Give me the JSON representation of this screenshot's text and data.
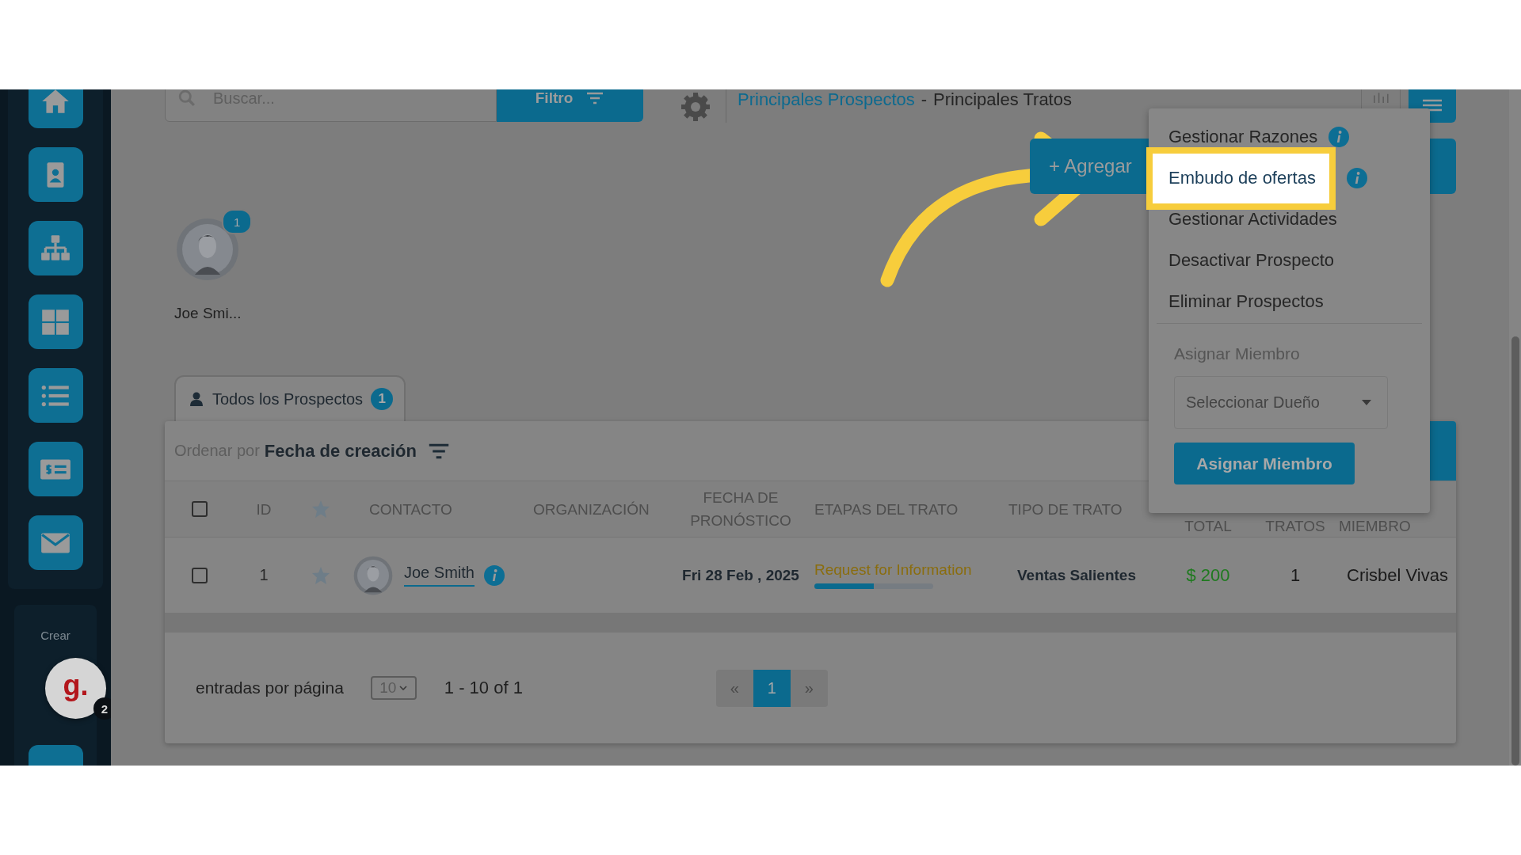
{
  "sidebar": {
    "section_label": "Crear",
    "widget": {
      "letter": "g.",
      "badge": "2"
    }
  },
  "search": {
    "placeholder": "Buscar..."
  },
  "filter_button": "Filtro",
  "breadcrumb": {
    "link": "Principales Prospectos",
    "separator": "-",
    "current": "Principales Tratos"
  },
  "add_button": "+ Agregar",
  "prospects": [
    {
      "name": "Joe Smi...",
      "badge": "1"
    }
  ],
  "tabs": [
    {
      "label": "Todos los Prospectos",
      "badge": "1",
      "selected": true
    }
  ],
  "sort": {
    "label": "Ordenar por",
    "value": "Fecha de creación"
  },
  "table": {
    "header_checked": false,
    "columns": [
      {
        "kind": "checkbox"
      },
      {
        "kind": "text",
        "label": "ID"
      },
      {
        "kind": "star"
      },
      {
        "kind": "text",
        "label": "CONTACTO"
      },
      {
        "kind": "text",
        "label": "ORGANIZACIÓN"
      },
      {
        "kind": "text",
        "label": "FECHA DE PRONÓSTICO"
      },
      {
        "kind": "text",
        "label": "ETAPAS DEL TRATO"
      },
      {
        "kind": "text",
        "label": "TIPO DE TRATO"
      },
      {
        "kind": "text",
        "label": "TOTAL"
      },
      {
        "kind": "text",
        "label": "TRATOS"
      },
      {
        "kind": "text",
        "label": "MIEMBRO"
      }
    ],
    "rows": [
      {
        "checked": false,
        "id": "1",
        "starred": false,
        "contact": "Joe Smith",
        "date": "Fri 28 Feb , 2025",
        "stage": {
          "label": "Request for Information",
          "level": 0.5
        },
        "type": "Ventas Salientes",
        "total": "$ 200",
        "deals": "1",
        "member": "Crisbel Vivas"
      }
    ]
  },
  "footer": {
    "per_page_label": "entradas por página",
    "per_page": "10",
    "range": "1 - 10 of 1"
  },
  "pagination": {
    "prev": "«",
    "pages": [
      {
        "label": "1",
        "selected": true
      }
    ],
    "next": "»"
  },
  "menu": {
    "items": [
      {
        "label": "Gestionar Razones",
        "info": true,
        "selected": false
      },
      {
        "label": "Embudo de ofertas",
        "info": true,
        "selected": true
      },
      {
        "label": "Gestionar Actividades",
        "info": false,
        "selected": false
      },
      {
        "label": "Desactivar Prospecto",
        "info": false,
        "selected": false
      },
      {
        "label": "Eliminar Prospectos",
        "info": false,
        "selected": false
      }
    ],
    "assign": {
      "label": "Asignar Miembro",
      "placeholder": "Seleccionar Dueño",
      "button": "Asignar Miembro"
    }
  }
}
